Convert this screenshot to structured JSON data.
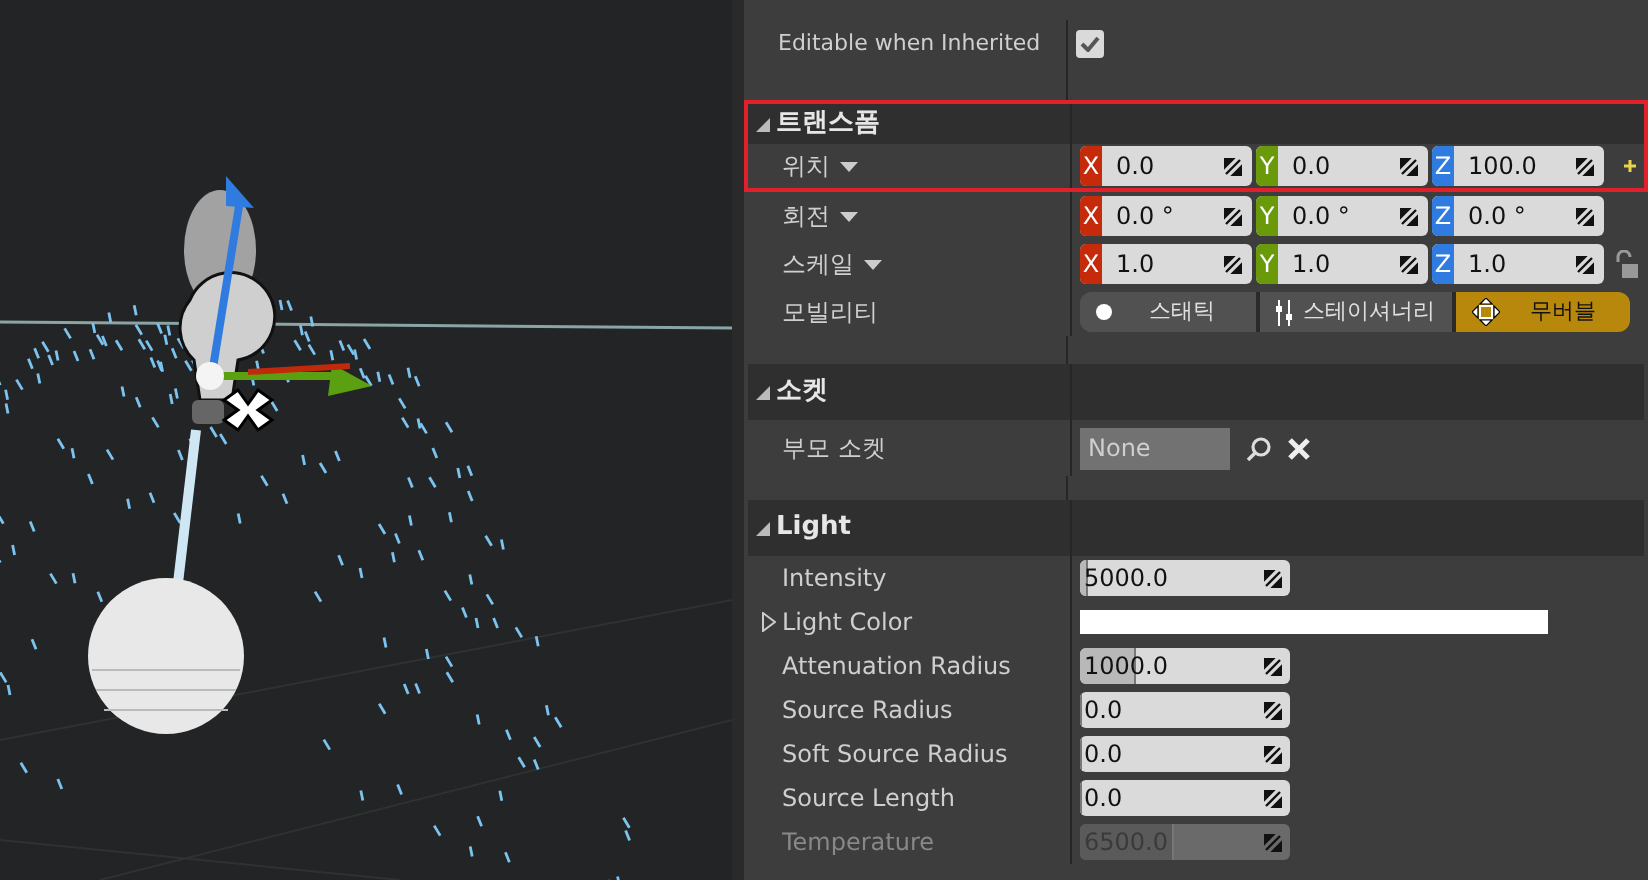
{
  "details": {
    "top_rows": [
      {
        "kind": "checkbox",
        "label": "Editable when Inherited",
        "checked": true
      }
    ],
    "sections": [
      {
        "title": "트랜스폼",
        "expanded": true,
        "highlighted": true,
        "rows": [
          {
            "kind": "vector",
            "label": "위치",
            "highlighted": true,
            "reset": true,
            "values": [
              "0.0",
              "0.0",
              "100.0"
            ],
            "axes": [
              "X",
              "Y",
              "Z"
            ],
            "lock": false
          },
          {
            "kind": "vector",
            "label": "회전",
            "highlighted": false,
            "reset": false,
            "values": [
              "0.0 °",
              "0.0 °",
              "0.0 °"
            ],
            "axes": [
              "X",
              "Y",
              "Z"
            ],
            "lock": false
          },
          {
            "kind": "vector",
            "label": "스케일",
            "highlighted": false,
            "reset": false,
            "values": [
              "1.0",
              "1.0",
              "1.0"
            ],
            "axes": [
              "X",
              "Y",
              "Z"
            ],
            "lock": true
          },
          {
            "kind": "segmented",
            "label": "모빌리티",
            "highlighted": false,
            "options": [
              {
                "label": "스태틱",
                "selected": false
              },
              {
                "label": "스테이셔너리",
                "selected": false
              },
              {
                "label": "무버블",
                "selected": true
              }
            ]
          }
        ]
      },
      {
        "title": "소켓",
        "expanded": true,
        "highlighted": false,
        "rows": [
          {
            "kind": "socket",
            "label": "부모 소켓",
            "highlighted": false,
            "value": "None"
          }
        ]
      },
      {
        "title": "Light",
        "expanded": true,
        "highlighted": false,
        "rows": [
          {
            "kind": "number",
            "label": "Intensity",
            "highlighted": false,
            "value": "5000.0",
            "level": 0.04,
            "disabled": false
          },
          {
            "kind": "color",
            "label": "Light Color",
            "highlighted": false,
            "expanded": false,
            "color": "#ffffff"
          },
          {
            "kind": "number",
            "label": "Attenuation Radius",
            "highlighted": false,
            "value": "1000.0",
            "level": 0.27,
            "disabled": false
          },
          {
            "kind": "number",
            "label": "Source Radius",
            "highlighted": false,
            "value": "0.0",
            "level": 0,
            "disabled": false
          },
          {
            "kind": "number",
            "label": "Soft Source Radius",
            "highlighted": false,
            "value": "0.0",
            "level": 0,
            "disabled": false
          },
          {
            "kind": "number",
            "label": "Source Length",
            "highlighted": false,
            "value": "0.0",
            "level": 0,
            "disabled": false
          },
          {
            "kind": "number",
            "label": "Temperature",
            "highlighted": false,
            "value": "6500.0",
            "level": 0.45,
            "disabled": true
          }
        ]
      }
    ]
  }
}
